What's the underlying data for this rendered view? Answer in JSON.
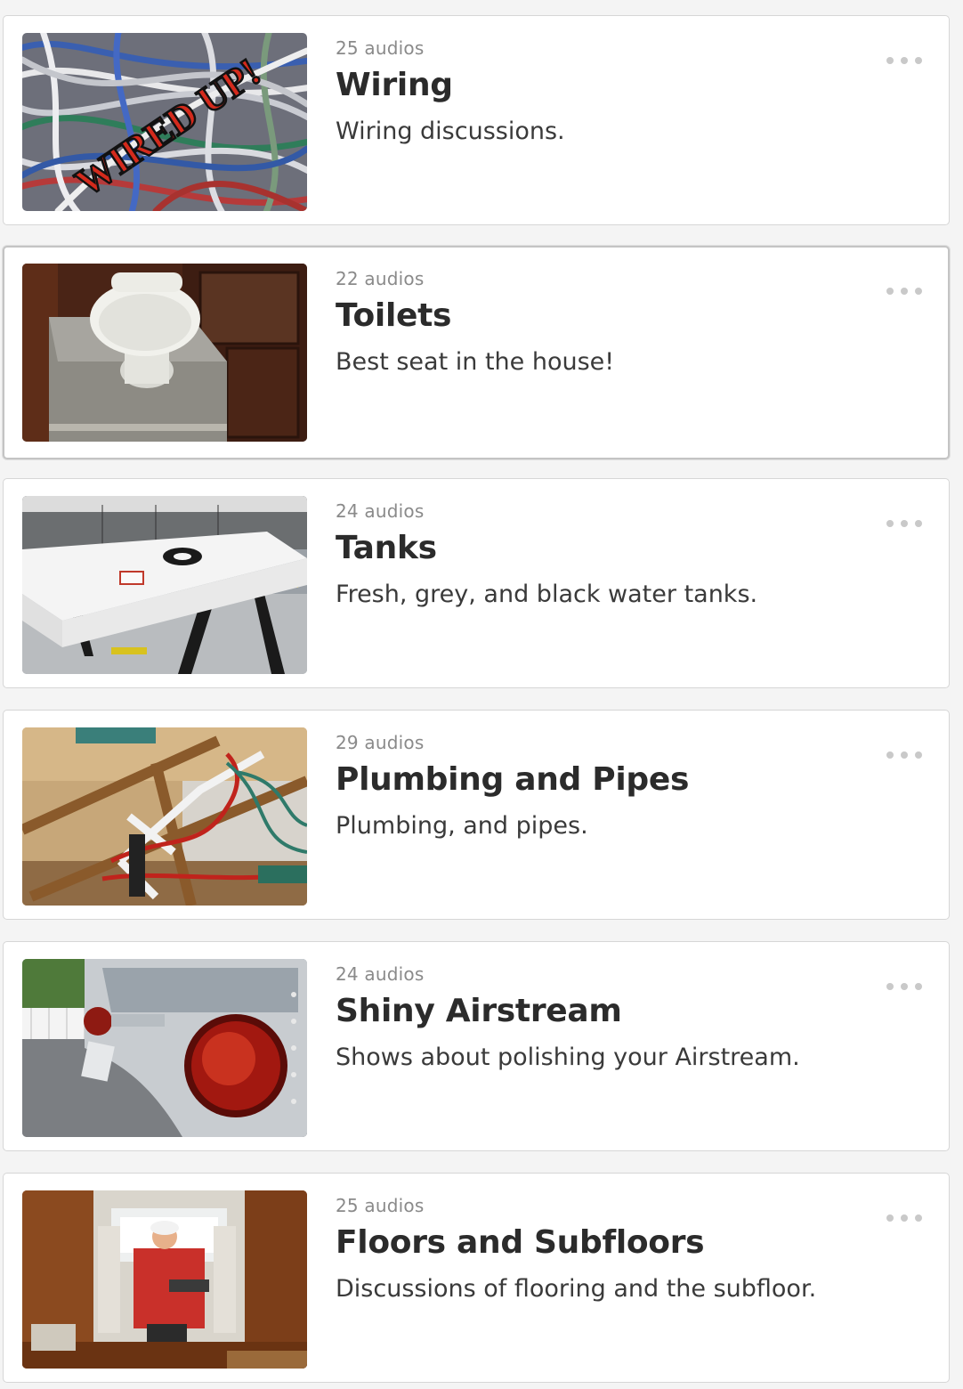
{
  "playlists": [
    {
      "count": "25 audios",
      "title": "Wiring",
      "description": "Wiring discussions.",
      "thumb_text": "WIRED UP!"
    },
    {
      "count": "22 audios",
      "title": "Toilets",
      "description": "Best seat in the house!"
    },
    {
      "count": "24 audios",
      "title": "Tanks",
      "description": "Fresh, grey, and black water tanks."
    },
    {
      "count": "29 audios",
      "title": "Plumbing and Pipes",
      "description": "Plumbing, and pipes."
    },
    {
      "count": "24 audios",
      "title": "Shiny Airstream",
      "description": "Shows about polishing your Airstream."
    },
    {
      "count": "25 audios",
      "title": "Floors and Subfloors",
      "description": "Discussions of flooring and the subfloor."
    }
  ],
  "icons": {
    "more": "more-options-icon"
  },
  "colors": {
    "card_bg": "#ffffff",
    "page_bg": "#f4f4f4",
    "title": "#2b2b2b",
    "count": "#8a8a8a"
  }
}
